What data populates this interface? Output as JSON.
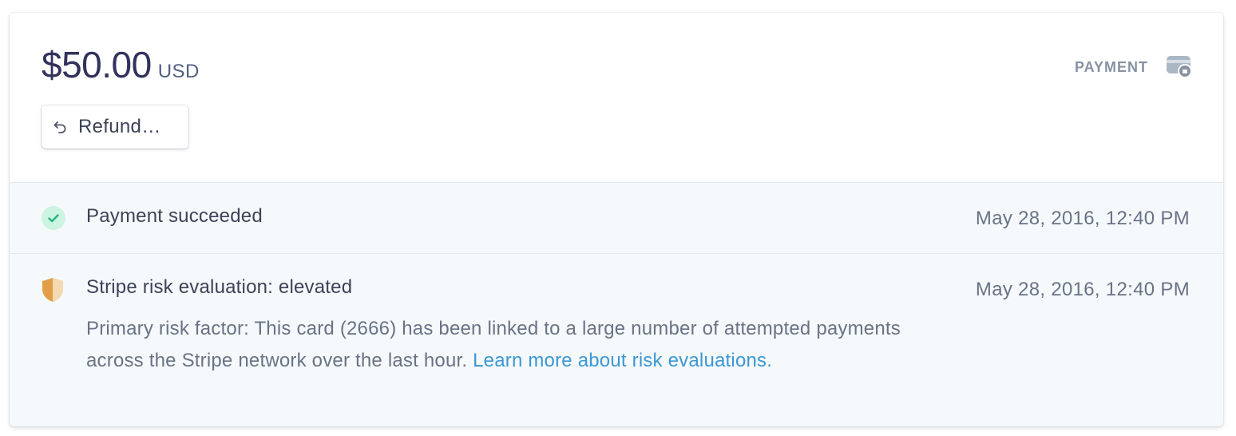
{
  "payment": {
    "amount": "$50.00",
    "currency": "USD",
    "type_label": "PAYMENT",
    "type_icon": "payment-card-icon"
  },
  "actions": {
    "refund_label": "Refund…"
  },
  "timeline": [
    {
      "icon": "check-circle-icon",
      "title": "Payment succeeded",
      "time": "May 28, 2016, 12:40 PM"
    },
    {
      "icon": "shield-icon",
      "title": "Stripe risk evaluation: elevated",
      "time": "May 28, 2016, 12:40 PM",
      "description": "Primary risk factor: This card (2666) has been linked to a large number of attempted payments across the Stripe network over the last hour.",
      "link_text": "Learn more about risk evaluations."
    }
  ],
  "colors": {
    "success": "#24b47e",
    "warning": "#e39f48",
    "link": "#3a97d4"
  }
}
